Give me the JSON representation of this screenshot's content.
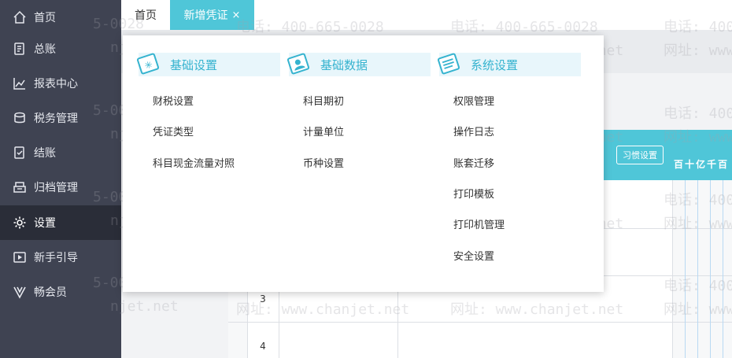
{
  "sidebar": {
    "items": [
      {
        "label": "首页",
        "icon": "home-icon"
      },
      {
        "label": "总账",
        "icon": "ledger-icon"
      },
      {
        "label": "报表中心",
        "icon": "chart-icon"
      },
      {
        "label": "税务管理",
        "icon": "coins-icon"
      },
      {
        "label": "结账",
        "icon": "checkout-icon"
      },
      {
        "label": "归档管理",
        "icon": "archive-icon"
      },
      {
        "label": "设置",
        "icon": "gear-icon"
      },
      {
        "label": "新手引导",
        "icon": "play-guide-icon"
      },
      {
        "label": "畅会员",
        "icon": "member-v-icon"
      }
    ],
    "active_index": 6
  },
  "tabs": {
    "home": "首页",
    "active": "新增凭证",
    "close": "×"
  },
  "toolbar": {
    "habit_settings": "习惯设置",
    "amount_header": "百十亿千百"
  },
  "table": {
    "rows": [
      "3",
      "4"
    ]
  },
  "watermark": {
    "phone": "电话: 400-665-0028",
    "site": "网址: www.chanjet.net",
    "phone_fragment": "5-0028",
    "site_fragment": "njet.net",
    "phone_edge": "电话: 400",
    "site_edge": "网址: www"
  },
  "menu": {
    "columns": [
      {
        "title": "基础设置",
        "icon": "basic-settings-icon",
        "items": [
          "财税设置",
          "凭证类型",
          "科目现金流量对照"
        ]
      },
      {
        "title": "基础数据",
        "icon": "basic-data-icon",
        "items": [
          "科目期初",
          "计量单位",
          "币种设置"
        ]
      },
      {
        "title": "系统设置",
        "icon": "system-settings-icon",
        "items": [
          "权限管理",
          "操作日志",
          "账套迁移",
          "打印模板",
          "打印机管理",
          "安全设置"
        ]
      }
    ]
  },
  "colors": {
    "sidebar_bg": "#3f4352",
    "sidebar_active": "#2a2d38",
    "accent": "#4fc6d8",
    "menu_title": "#35b3cf"
  }
}
